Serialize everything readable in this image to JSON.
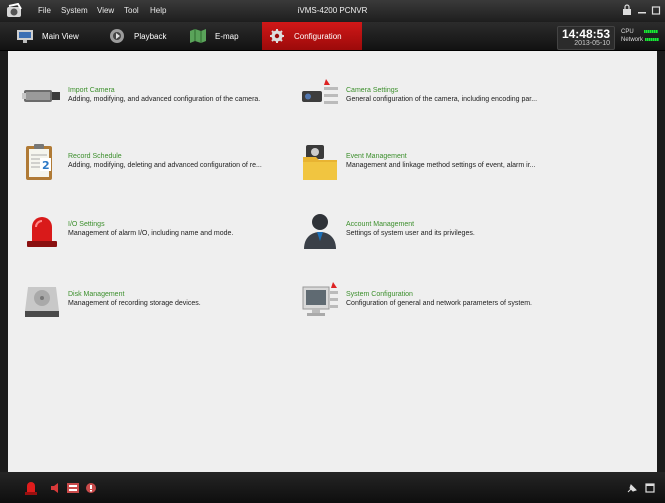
{
  "menubar": {
    "items": [
      "File",
      "System",
      "View",
      "Tool",
      "Help"
    ],
    "app_title": "iVMS-4200 PCNVR"
  },
  "tabs": [
    {
      "label": "Main View",
      "icon": "monitor-icon"
    },
    {
      "label": "Playback",
      "icon": "playback-icon"
    },
    {
      "label": "E-map",
      "icon": "emap-icon"
    },
    {
      "label": "Configuration",
      "icon": "configuration-icon",
      "active": true
    }
  ],
  "status": {
    "time": "14:48:53",
    "date": "2013-05-10",
    "cpu_label": "CPU",
    "network_label": "Network"
  },
  "config_items": [
    {
      "title": "Import Camera",
      "desc": "Adding, modifying, and advanced configuration of the camera.",
      "icon": "camera-icon"
    },
    {
      "title": "Camera Settings",
      "desc": "General configuration of the camera, including encoding par...",
      "icon": "camera-settings-icon"
    },
    {
      "title": "Record Schedule",
      "desc": "Adding, modifying, deleting and advanced configuration of re...",
      "icon": "schedule-clipboard-icon"
    },
    {
      "title": "Event Management",
      "desc": "Management and linkage method settings of event, alarm ir...",
      "icon": "event-folder-icon"
    },
    {
      "title": "I/O Settings",
      "desc": "Management of alarm I/O, including name and mode.",
      "icon": "alarm-light-icon"
    },
    {
      "title": "Account Management",
      "desc": "Settings of system user and its privileges.",
      "icon": "user-account-icon"
    },
    {
      "title": "Disk Management",
      "desc": "Management of recording storage devices.",
      "icon": "hard-disk-icon"
    },
    {
      "title": "System Configuration",
      "desc": "Configuration of general and network parameters of system.",
      "icon": "system-config-icon"
    }
  ],
  "colors": {
    "accent": "#c8141c",
    "title_green": "#3c8f2c",
    "background": "#efefef"
  }
}
